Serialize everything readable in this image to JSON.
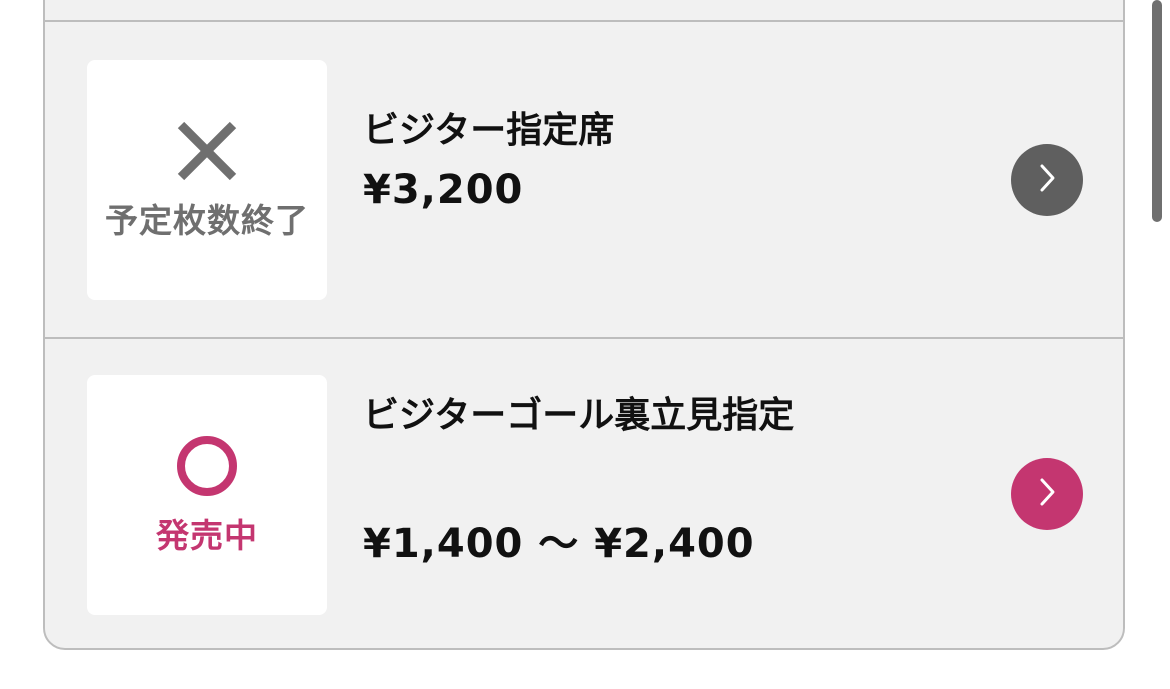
{
  "items": [
    {
      "status_label": "予定枚数終了",
      "status_icon": "cross-icon",
      "status_color": "#6f6f6f",
      "title": "ビジター指定席",
      "price": "¥3,200",
      "arrow_color": "#5f5f5f"
    },
    {
      "status_label": "発売中",
      "status_icon": "circle-icon",
      "status_color": "#c43670",
      "title": "ビジターゴール裏立見指定",
      "price": "¥1,400 〜 ¥2,400",
      "arrow_color": "#c43670"
    }
  ],
  "colors": {
    "card_background": "#f1f1f1",
    "border": "#bdbdbd",
    "accent": "#c43670"
  }
}
